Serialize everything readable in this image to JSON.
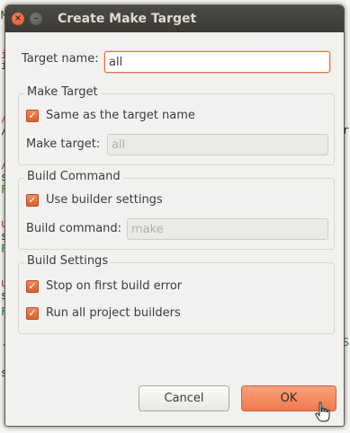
{
  "background": {
    "left_glyphs": [
      "M",
      "i",
      "i",
      "/",
      "/",
      "/",
      "s",
      "F",
      "u",
      "s",
      "F",
      "u",
      "s",
      "F",
      ".)",
      "s"
    ],
    "right_glyphs": [
      "r",
      "S"
    ]
  },
  "window": {
    "title": "Create Make Target",
    "close_glyph": "×",
    "minimize_glyph": "–"
  },
  "target_name": {
    "label": "Target name:",
    "value": "all"
  },
  "make_target_group": {
    "title": "Make Target",
    "same_as_target": {
      "label": "Same as the target name",
      "checked": true
    },
    "make_target": {
      "label": "Make target:",
      "value": "all"
    }
  },
  "build_command_group": {
    "title": "Build Command",
    "use_builder_settings": {
      "label": "Use builder settings",
      "checked": true
    },
    "build_command": {
      "label": "Build command:",
      "value": "make"
    }
  },
  "build_settings_group": {
    "title": "Build Settings",
    "stop_on_error": {
      "label": "Stop on first build error",
      "checked": true
    },
    "run_all_builders": {
      "label": "Run all project builders",
      "checked": true
    }
  },
  "buttons": {
    "cancel": "Cancel",
    "ok": "OK"
  },
  "colors": {
    "accent": "#e0713b",
    "titlebar": "#3c3b37",
    "dialog_bg": "#f2f1ef"
  }
}
